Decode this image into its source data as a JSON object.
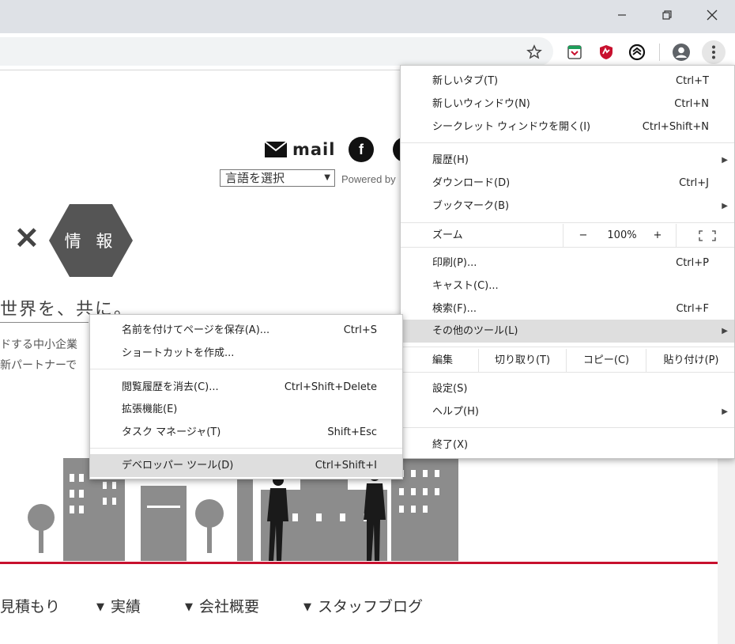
{
  "page": {
    "mail_label": "mail",
    "facebook_letter": "f",
    "language_select": "言語を選択",
    "powered_by": "Powered by",
    "hex_label": "情 報",
    "tagline": "世界を、共に。",
    "body_line1": "ドする中小企業",
    "body_line2": "新パートナーで",
    "nav": [
      {
        "label": "見積もり"
      },
      {
        "label": "実績"
      },
      {
        "label": "会社概要"
      },
      {
        "label": "スタッフブログ"
      }
    ],
    "colors": {
      "accent_red": "#c8102e",
      "titlebar": "#dee1e6",
      "hexagon": "#555555"
    }
  },
  "chrome_menu": {
    "items": [
      {
        "label": "新しいタブ(T)",
        "shortcut": "Ctrl+T"
      },
      {
        "label": "新しいウィンドウ(N)",
        "shortcut": "Ctrl+N"
      },
      {
        "label": "シークレット ウィンドウを開く(I)",
        "shortcut": "Ctrl+Shift+N"
      },
      {
        "label": "履歴(H)",
        "shortcut": ""
      },
      {
        "label": "ダウンロード(D)",
        "shortcut": "Ctrl+J"
      },
      {
        "label": "ブックマーク(B)",
        "shortcut": ""
      },
      {
        "label": "印刷(P)...",
        "shortcut": "Ctrl+P"
      },
      {
        "label": "キャスト(C)...",
        "shortcut": ""
      },
      {
        "label": "検索(F)...",
        "shortcut": "Ctrl+F"
      },
      {
        "label": "その他のツール(L)",
        "shortcut": ""
      },
      {
        "label": "設定(S)",
        "shortcut": ""
      },
      {
        "label": "ヘルプ(H)",
        "shortcut": ""
      },
      {
        "label": "終了(X)",
        "shortcut": ""
      }
    ],
    "zoom": {
      "label": "ズーム",
      "minus": "−",
      "value": "100%",
      "plus": "+"
    },
    "edit": {
      "label": "編集",
      "cut": "切り取り(T)",
      "copy": "コピー(C)",
      "paste": "貼り付け(P)"
    }
  },
  "more_tools_menu": {
    "items": [
      {
        "label": "名前を付けてページを保存(A)...",
        "shortcut": "Ctrl+S"
      },
      {
        "label": "ショートカットを作成...",
        "shortcut": ""
      },
      {
        "label": "閲覧履歴を消去(C)...",
        "shortcut": "Ctrl+Shift+Delete"
      },
      {
        "label": "拡張機能(E)",
        "shortcut": ""
      },
      {
        "label": "タスク マネージャ(T)",
        "shortcut": "Shift+Esc"
      },
      {
        "label": "デベロッパー ツール(D)",
        "shortcut": "Ctrl+Shift+I"
      }
    ]
  },
  "toolbar": {
    "icons": [
      "star-icon",
      "extension-pocket-icon",
      "extension-mcafee-icon",
      "extension-shield-icon",
      "profile-icon",
      "more-menu-icon"
    ]
  }
}
